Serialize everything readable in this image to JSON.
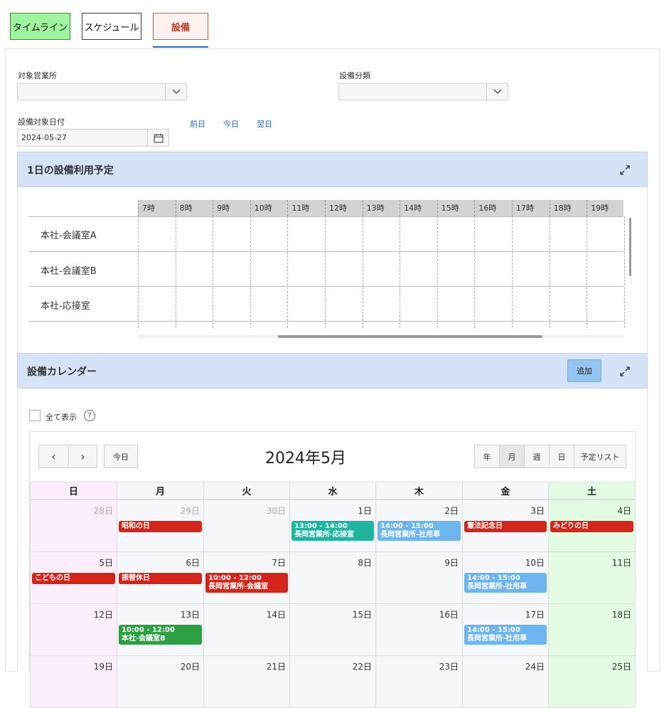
{
  "tabs": [
    {
      "label": "タイムライン"
    },
    {
      "label": "スケジュール"
    },
    {
      "label": "設備"
    }
  ],
  "filters": {
    "office_label": "対象営業所",
    "category_label": "設備分類",
    "date_label": "設備対象日付",
    "date_value": "2024-05-27",
    "prev_day": "前日",
    "today": "今日",
    "next_day": "翌日"
  },
  "timeline": {
    "title": "1日の設備利用予定",
    "hours": [
      "7時",
      "8時",
      "9時",
      "10時",
      "11時",
      "12時",
      "13時",
      "14時",
      "15時",
      "16時",
      "17時",
      "18時",
      "19時"
    ],
    "rows": [
      "本社-会議室A",
      "本社-会議室B",
      "本社-応接室"
    ]
  },
  "calendar": {
    "title": "設備カレンダー",
    "add_label": "追加",
    "show_all_label": "全て表示",
    "help_glyph": "?",
    "prev_glyph": "‹",
    "next_glyph": "›",
    "today_label": "今日",
    "month_title": "2024年5月",
    "views": [
      "年",
      "月",
      "週",
      "日",
      "予定リスト"
    ],
    "days_of_week": [
      "日",
      "月",
      "火",
      "水",
      "木",
      "金",
      "土"
    ],
    "weeks": [
      [
        {
          "day": "28日",
          "other": true
        },
        {
          "day": "29日",
          "other": true,
          "events": [
            {
              "text": "昭和の日",
              "color": "#d4251c"
            }
          ]
        },
        {
          "day": "30日",
          "other": true
        },
        {
          "day": "1日",
          "events": [
            {
              "time": "13:00 - 14:00",
              "text": "長岡営業所-応接室",
              "color": "#1fb5a0"
            }
          ]
        },
        {
          "day": "2日",
          "events": [
            {
              "time": "14:00 - 15:00",
              "text": "長岡営業所-社用車",
              "color": "#6db5ef"
            }
          ]
        },
        {
          "day": "3日",
          "events": [
            {
              "text": "憲法記念日",
              "color": "#d4251c"
            }
          ]
        },
        {
          "day": "4日",
          "events": [
            {
              "text": "みどりの日",
              "color": "#d4251c"
            }
          ]
        }
      ],
      [
        {
          "day": "5日",
          "events": [
            {
              "text": "こどもの日",
              "color": "#d4251c"
            }
          ]
        },
        {
          "day": "6日",
          "events": [
            {
              "text": "振替休日",
              "color": "#d4251c"
            }
          ]
        },
        {
          "day": "7日",
          "events": [
            {
              "time": "10:00 - 12:00",
              "text": "長岡営業所-会議室",
              "color": "#d4251c"
            }
          ]
        },
        {
          "day": "8日"
        },
        {
          "day": "9日"
        },
        {
          "day": "10日",
          "events": [
            {
              "time": "14:00 - 15:00",
              "text": "長岡営業所-社用車",
              "color": "#6db5ef"
            }
          ]
        },
        {
          "day": "11日"
        }
      ],
      [
        {
          "day": "12日"
        },
        {
          "day": "13日",
          "events": [
            {
              "time": "10:00 - 12:00",
              "text": "本社-会議室B",
              "color": "#2ea044"
            }
          ]
        },
        {
          "day": "14日"
        },
        {
          "day": "15日"
        },
        {
          "day": "16日"
        },
        {
          "day": "17日",
          "events": [
            {
              "time": "14:00 - 15:00",
              "text": "長岡営業所-社用車",
              "color": "#6db5ef"
            }
          ]
        },
        {
          "day": "18日"
        }
      ],
      [
        {
          "day": "19日"
        },
        {
          "day": "20日"
        },
        {
          "day": "21日"
        },
        {
          "day": "22日"
        },
        {
          "day": "23日"
        },
        {
          "day": "24日"
        },
        {
          "day": "25日"
        }
      ]
    ]
  },
  "colors": {
    "sunday_bg": "#fdeefd",
    "weekday_bg": "#f6f7fb",
    "saturday_bg": "#e3fbe3",
    "accent": "#2f67b8"
  }
}
